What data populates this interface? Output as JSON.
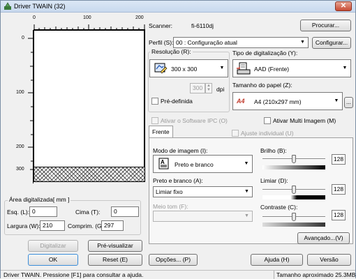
{
  "window": {
    "title": "Driver TWAIN (32)",
    "close_glyph": "✕"
  },
  "ruler": {
    "top_labels": [
      "0",
      "100",
      "200"
    ],
    "left_labels": [
      "0",
      "100",
      "200",
      "300"
    ]
  },
  "area": {
    "title": "Área digitalizada[ mm ]",
    "left_label": "Esq. (L):",
    "left_value": "0",
    "top_label": "Cima (T):",
    "top_value": "0",
    "width_label": "Largura (W):",
    "width_value": "210",
    "length_label": "Comprim. (G):",
    "length_value": "297"
  },
  "left_buttons": {
    "scan": "Digitalizar",
    "preview": "Pré-visualizar",
    "ok": "OK",
    "reset": "Reset (E)"
  },
  "scanner": {
    "label": "Scanner:",
    "value": "fi-6110dj",
    "browse": "Procurar..."
  },
  "profile": {
    "label": "Perfil (S):",
    "value": "00 : Configuração atual",
    "configure": "Configurar..."
  },
  "resolution": {
    "title": "Resolução (R):",
    "value": "300 x 300",
    "custom_value": "300",
    "unit": "dpi",
    "predefined": "Pré-definida"
  },
  "scan_type": {
    "title": "Tipo de digitalização (Y):",
    "value": "AAD (Frente)"
  },
  "paper_size": {
    "title": "Tamanho do papel (Z):",
    "value": "A4 (210x297 mm)",
    "more": "...",
    "icon_text": "A4"
  },
  "ipc": {
    "label": "Ativar o Software IPC (O)"
  },
  "multi_image": {
    "label": "Ativar Multi Imagem (M)"
  },
  "tab_front": "Frente",
  "individual": {
    "label": "Ajuste individual (U)"
  },
  "image_mode": {
    "title": "Modo de imagem (I):",
    "value": "Preto e branco"
  },
  "bw": {
    "title": "Preto e branco (A):",
    "value": "Limiar fixo"
  },
  "halftone": {
    "title": "Meio tom (F):"
  },
  "brightness": {
    "title": "Brilho (B):",
    "value": "128",
    "level": 0.5
  },
  "threshold": {
    "title": "Limiar (D):",
    "value": "128",
    "level": 0.5
  },
  "contrast": {
    "title": "Contraste (C):",
    "value": "128",
    "level": 0.5
  },
  "advanced": "Avançado...(V)",
  "bottom_buttons": {
    "options": "Opções... (P)",
    "help": "Ajuda (H)",
    "version": "Versão"
  },
  "status": {
    "left": "Driver TWAIN. Pressione [F1] para consultar a ajuda.",
    "right": "Tamanho aproximado  25.3MB"
  }
}
